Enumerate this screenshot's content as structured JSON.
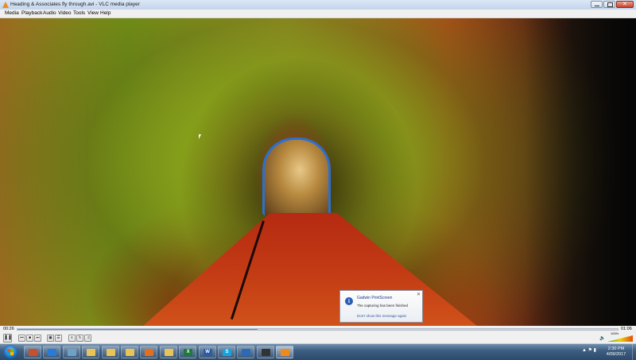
{
  "window": {
    "title": "Heading & Associates fly through.avi - VLC media player"
  },
  "menu": [
    "Media",
    "Playback",
    "Audio",
    "Video",
    "Tools",
    "View",
    "Help"
  ],
  "player": {
    "time_elapsed": "00:26",
    "time_total": "01:06",
    "progress": 0.4,
    "volume_percent": "100%"
  },
  "notification": {
    "app": "Gadwin PrintScreen",
    "message": "The capturing has been finished",
    "link": "Don't show this message again"
  },
  "taskbar": {
    "apps": [
      {
        "icon": "media-center-icon",
        "color": "#c8502a"
      },
      {
        "icon": "internet-explorer-icon",
        "color": "#2a7ad8"
      },
      {
        "icon": "pen-app-icon",
        "color": "#6fa0c8"
      },
      {
        "icon": "folder-icon",
        "color": "#e8c458"
      },
      {
        "icon": "folder-icon",
        "color": "#e8c458"
      },
      {
        "icon": "folder-icon",
        "color": "#e8c458"
      },
      {
        "icon": "media-player-icon",
        "color": "#e07020"
      },
      {
        "icon": "folder-icon",
        "color": "#e8c458"
      },
      {
        "icon": "excel-icon",
        "color": "#1e7a3a",
        "glyph": "X"
      },
      {
        "icon": "word-icon",
        "color": "#2a5aa8",
        "glyph": "W"
      },
      {
        "icon": "skype-icon",
        "color": "#12a5e0",
        "glyph": "S"
      },
      {
        "icon": "recap-icon",
        "color": "#2a6ab8"
      },
      {
        "icon": "lens-app-icon",
        "color": "#333333"
      },
      {
        "icon": "vlc-icon",
        "color": "#f08a1c"
      }
    ],
    "clock_time": "2:30 PM",
    "clock_date": "4/09/2017"
  }
}
